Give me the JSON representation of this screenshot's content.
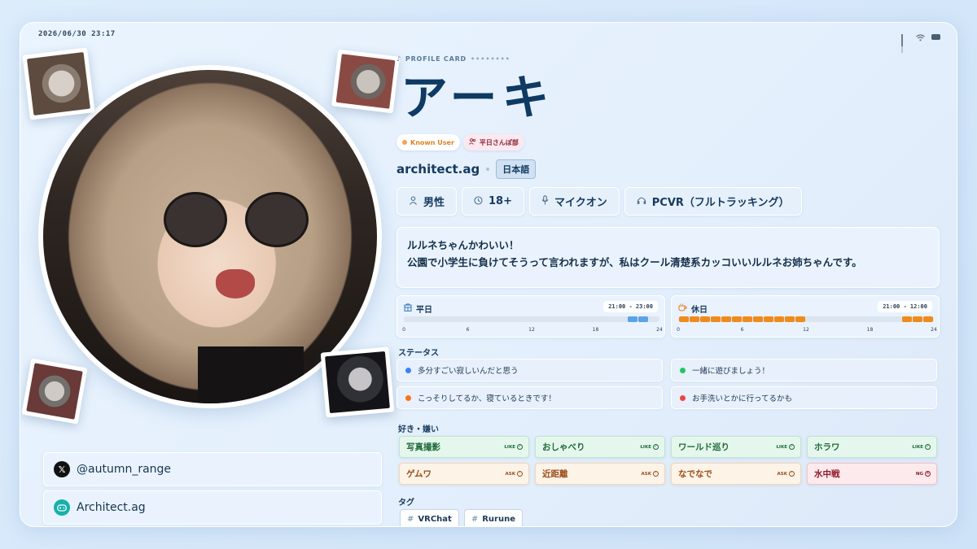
{
  "header": {
    "timestamp": "2026/06/30 23:17",
    "icons": [
      "signal-icon",
      "wifi-icon",
      "battery-icon"
    ]
  },
  "profile": {
    "eyebrow": "PROFILE CARD",
    "eyebrow_dots": "••••••••",
    "name": "アーキ",
    "badges": {
      "known": "Known User",
      "group": "平日さんぽ部"
    },
    "handle": "architect.ag",
    "language": "日本語",
    "facts": [
      {
        "icon": "person-icon",
        "label": "男性"
      },
      {
        "icon": "age-icon",
        "label": "18+"
      },
      {
        "icon": "mic-icon",
        "label": "マイクオン"
      },
      {
        "icon": "headset-icon",
        "label": "PCVR（フルトラッキング）"
      }
    ],
    "bio_lines": [
      "ルルネちゃんかわいい！",
      "公園で小学生に負けてそうって言われますが、私はクール清楚系カッコいいルルネお姉ちゃんです。"
    ]
  },
  "schedule": {
    "weekday": {
      "label": "平日",
      "range": "21:00 - 23:00",
      "color": "#5ba2e6",
      "active_hours": [
        21,
        22
      ]
    },
    "holiday": {
      "label": "休日",
      "range": "21:00 - 12:00",
      "color": "#f08a1c",
      "active_hours": [
        0,
        1,
        2,
        3,
        4,
        5,
        6,
        7,
        8,
        9,
        10,
        11,
        21,
        22,
        23
      ]
    },
    "ticks": [
      "0",
      "6",
      "12",
      "18",
      "24"
    ]
  },
  "status": {
    "title": "ステータス",
    "items": [
      {
        "text": "多分すごい寂しいんだと思う",
        "color": "#3b82f6"
      },
      {
        "text": "一緒に遊びましょう！",
        "color": "#22c55e"
      },
      {
        "text": "こっそりしてるか、寝ているときです！",
        "color": "#f97316"
      },
      {
        "text": "お手洗いとかに行ってるかも",
        "color": "#ef4444"
      }
    ]
  },
  "likes": {
    "title": "好き・嫌い",
    "items": [
      {
        "label": "写真撮影",
        "level": "LIKE"
      },
      {
        "label": "おしゃべり",
        "level": "LIKE"
      },
      {
        "label": "ワールド巡り",
        "level": "LIKE"
      },
      {
        "label": "ホラワ",
        "level": "LIKE"
      },
      {
        "label": "ゲムワ",
        "level": "ASK"
      },
      {
        "label": "近距離",
        "level": "ASK"
      },
      {
        "label": "なでなで",
        "level": "ASK"
      },
      {
        "label": "水中戦",
        "level": "NG"
      }
    ]
  },
  "tags": {
    "title": "タグ",
    "items": [
      "VRChat",
      "Rurune"
    ]
  },
  "social": [
    {
      "icon": "x-icon",
      "label": "@autumn_range",
      "color": "#111111"
    },
    {
      "icon": "gamepad-icon",
      "label": "Architect.ag",
      "color": "#16b1a8"
    }
  ]
}
